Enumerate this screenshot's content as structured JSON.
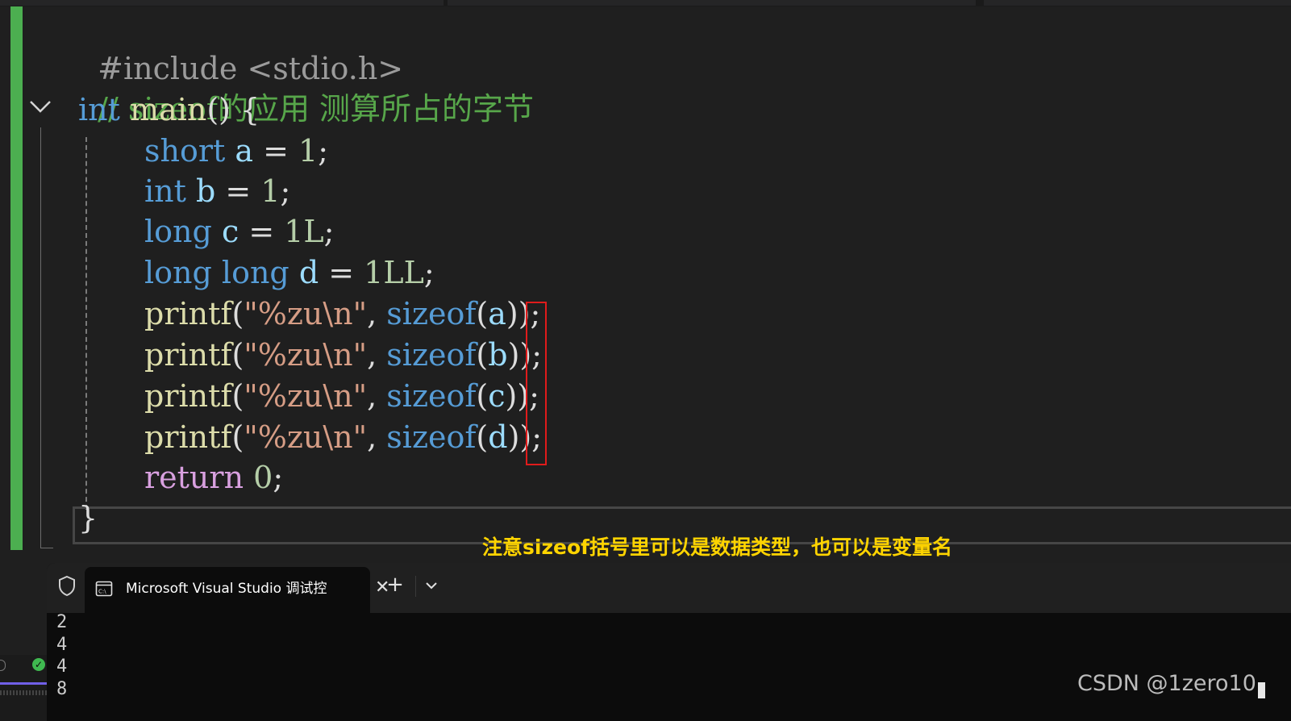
{
  "colors": {
    "editor_bg": "#1f1f1f",
    "keyword": "#569cd6",
    "comment": "#57a64a",
    "function": "#dcdcaa",
    "variable": "#9cdcfe",
    "string": "#d69d85",
    "number": "#b5cea8",
    "control_keyword": "#d8a0df",
    "change_bar": "#4caf50",
    "highlight_box": "#e01b1b",
    "annotation": "#ffd400",
    "terminal_bg": "#0c0c0c"
  },
  "editor": {
    "lines": [
      {
        "pp": "#include <stdio.h>"
      },
      {
        "comment": "// sizeof的应用 测算所占的字节"
      },
      {
        "kw": "int",
        "name": "main",
        "rest": "() {"
      },
      {
        "type": "short",
        "var": "a",
        "eq": " = ",
        "num": "1",
        "end": ";"
      },
      {
        "type": "int",
        "var": "b",
        "eq": " = ",
        "num": "1",
        "end": ";"
      },
      {
        "type": "long",
        "var": "c",
        "eq": " = ",
        "num": "1L",
        "end": ";"
      },
      {
        "type": "long long",
        "var": "d",
        "eq": " = ",
        "num": "1LL",
        "end": ";"
      },
      {
        "fn": "printf",
        "open": "(",
        "str": "\"%zu\\n\"",
        "comma": ", ",
        "sz": "sizeof",
        "p": "(",
        "arg": "a",
        "close": "));"
      },
      {
        "fn": "printf",
        "open": "(",
        "str": "\"%zu\\n\"",
        "comma": ", ",
        "sz": "sizeof",
        "p": "(",
        "arg": "b",
        "close": "));"
      },
      {
        "fn": "printf",
        "open": "(",
        "str": "\"%zu\\n\"",
        "comma": ", ",
        "sz": "sizeof",
        "p": "(",
        "arg": "c",
        "close": "));"
      },
      {
        "fn": "printf",
        "open": "(",
        "str": "\"%zu\\n\"",
        "comma": ", ",
        "sz": "sizeof",
        "p": "(",
        "arg": "d",
        "close": "));"
      },
      {
        "ret": "return",
        "num": "0",
        "end": ";"
      },
      {
        "brace": "}"
      }
    ]
  },
  "annotation": "注意sizeof括号里可以是数据类型，也可以是变量名",
  "terminal": {
    "tab_title": "Microsoft Visual Studio 调试控",
    "shield_icon": "shield-icon",
    "console_icon": "console-icon",
    "close_icon": "close-icon",
    "new_tab_label": "+",
    "dropdown_icon": "chevron-down-icon",
    "output": [
      "2",
      "4",
      "4",
      "8"
    ]
  },
  "watermark": "CSDN @1zero10"
}
